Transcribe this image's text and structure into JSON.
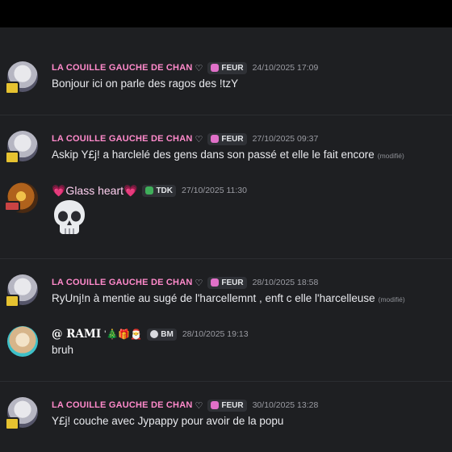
{
  "messages": [
    {
      "author": "LA COUILLE GAUCHE DE CHAN",
      "author_suffix": "♡",
      "tag_label": "FEUR",
      "timestamp": "24/10/2025 17:09",
      "text": "Bonjour ici on parle des ragos des !tzY"
    },
    {
      "author": "LA COUILLE GAUCHE DE CHAN",
      "author_suffix": "♡",
      "tag_label": "FEUR",
      "timestamp": "27/10/2025 09:37",
      "text": "Askip Y£j! a harclelé des gens dans son passé et elle le fait encore",
      "edited": "(modifié)"
    },
    {
      "author": "💗Glass heart💗",
      "tag_label": "TDK",
      "timestamp": "27/10/2025 11:30",
      "content": "skull-emoji"
    },
    {
      "author": "LA COUILLE GAUCHE DE CHAN",
      "author_suffix": "♡",
      "tag_label": "FEUR",
      "timestamp": "28/10/2025 18:58",
      "text": "RyUnj!n à mentie au sugé de l'harcellemnt , enft c elle l'harcelleuse",
      "edited": "(modifié)"
    },
    {
      "author": "@ RAMI",
      "author_suffix": "'🎄🎁🎅",
      "tag_label": "BM",
      "timestamp": "28/10/2025 19:13",
      "text": "bruh"
    },
    {
      "author": "LA COUILLE GAUCHE DE CHAN",
      "author_suffix": "♡",
      "tag_label": "FEUR",
      "timestamp": "30/10/2025 13:28",
      "text": "Y£j! couche avec Jypappy pour avoir de la popu"
    }
  ],
  "colors": {
    "background": "#1e1f22",
    "author_pink": "#ff8acb",
    "feur_tag_icon": "#e070c8",
    "tdk_tag_icon": "#3fae5a"
  }
}
